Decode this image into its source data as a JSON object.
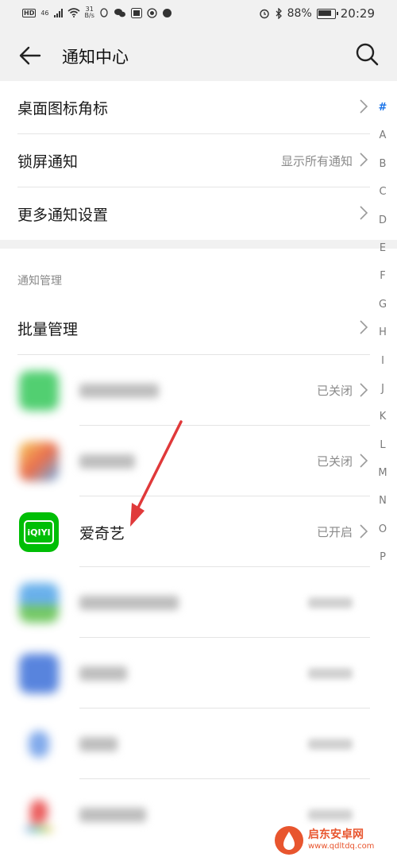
{
  "status_bar": {
    "left_hd": "HD",
    "left_net": "46",
    "left_speed_top": "31",
    "left_speed_bottom": "B/s",
    "right_battery": "88%",
    "right_time": "20:29"
  },
  "header": {
    "title": "通知中心"
  },
  "settings": {
    "rows": [
      {
        "label": "桌面图标角标",
        "value": ""
      },
      {
        "label": "锁屏通知",
        "value": "显示所有通知"
      },
      {
        "label": "更多通知设置",
        "value": ""
      }
    ]
  },
  "management": {
    "section_title": "通知管理",
    "batch_label": "批量管理",
    "apps": [
      {
        "name": "",
        "status": "已关闭",
        "icon_color": "#34c759"
      },
      {
        "name": "",
        "status": "已关闭",
        "icon_color": "#f0a030"
      },
      {
        "name": "爱奇艺",
        "status": "已开启",
        "icon_color": "#00be06"
      },
      {
        "name": "",
        "status": "",
        "icon_color": "#4fa3e8"
      },
      {
        "name": "",
        "status": "",
        "icon_color": "#3b6fd8"
      },
      {
        "name": "",
        "status": "",
        "icon_color": "#6b9be8"
      },
      {
        "name": "",
        "status": "",
        "icon_color": "#e84040"
      }
    ]
  },
  "alpha_index": [
    "#",
    "A",
    "B",
    "C",
    "D",
    "E",
    "F",
    "G",
    "H",
    "I",
    "J",
    "K",
    "L",
    "M",
    "N",
    "O",
    "P"
  ],
  "iqiyi_logo_text": "iQIYI",
  "watermark": {
    "title": "启东安卓网",
    "url": "www.qdltdq.com"
  },
  "colors": {
    "accent": "#1a73e8",
    "arrow": "#e0393a",
    "iqiyi": "#00be06"
  }
}
